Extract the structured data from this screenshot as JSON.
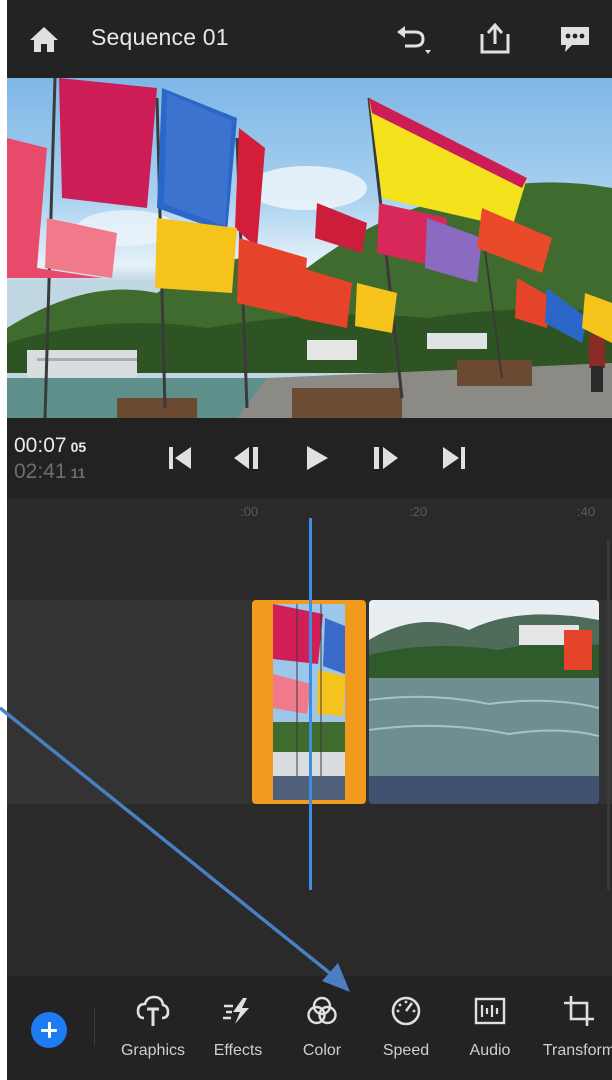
{
  "header": {
    "title": "Sequence 01",
    "icons": [
      "home-icon",
      "undo-icon",
      "share-icon",
      "feedback-icon"
    ]
  },
  "playback": {
    "current_time": "00:07",
    "current_frames": "05",
    "total_time": "02:41",
    "total_frames": "11",
    "buttons": [
      "skip-to-start-icon",
      "previous-frame-icon",
      "play-icon",
      "next-frame-icon",
      "skip-to-end-icon"
    ]
  },
  "ruler": {
    "ticks": [
      ":00",
      ":20",
      ":40"
    ]
  },
  "toolbar": {
    "add_button": "add-media",
    "tools": [
      {
        "label": "Graphics",
        "icon": "graphics-icon"
      },
      {
        "label": "Effects",
        "icon": "effects-icon"
      },
      {
        "label": "Color",
        "icon": "color-icon"
      },
      {
        "label": "Speed",
        "icon": "speed-icon"
      },
      {
        "label": "Audio",
        "icon": "audio-icon"
      },
      {
        "label": "Transform",
        "icon": "transform-icon"
      }
    ]
  },
  "colors": {
    "accent": "#1d7cf2",
    "selection": "#f29a1e",
    "playhead": "#3d8de2",
    "annotation": "#4a7fc1",
    "background": "#2a2a2a"
  }
}
